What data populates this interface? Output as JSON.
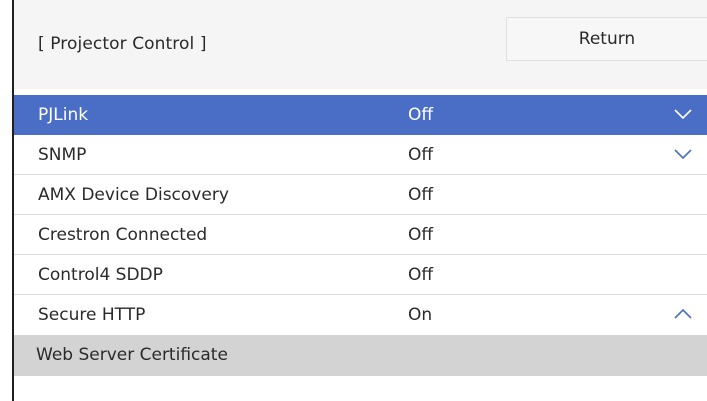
{
  "header": {
    "title": "[ Projector Control ]",
    "return_label": "Return"
  },
  "colors": {
    "selected_row": "#4a6ec5",
    "submenu_bg": "#d3d3d3"
  },
  "rows": [
    {
      "label": "PJLink",
      "value": "Off",
      "icon": "chevron-down-icon",
      "selected": true
    },
    {
      "label": "SNMP",
      "value": "Off",
      "icon": "chevron-down-icon",
      "selected": false
    },
    {
      "label": "AMX Device Discovery",
      "value": "Off",
      "icon": null,
      "selected": false
    },
    {
      "label": "Crestron Connected",
      "value": "Off",
      "icon": null,
      "selected": false
    },
    {
      "label": "Control4 SDDP",
      "value": "Off",
      "icon": null,
      "selected": false
    },
    {
      "label": "Secure HTTP",
      "value": "On",
      "icon": "chevron-up-icon",
      "selected": false
    }
  ],
  "submenu": {
    "label": "Web Server Certificate"
  }
}
